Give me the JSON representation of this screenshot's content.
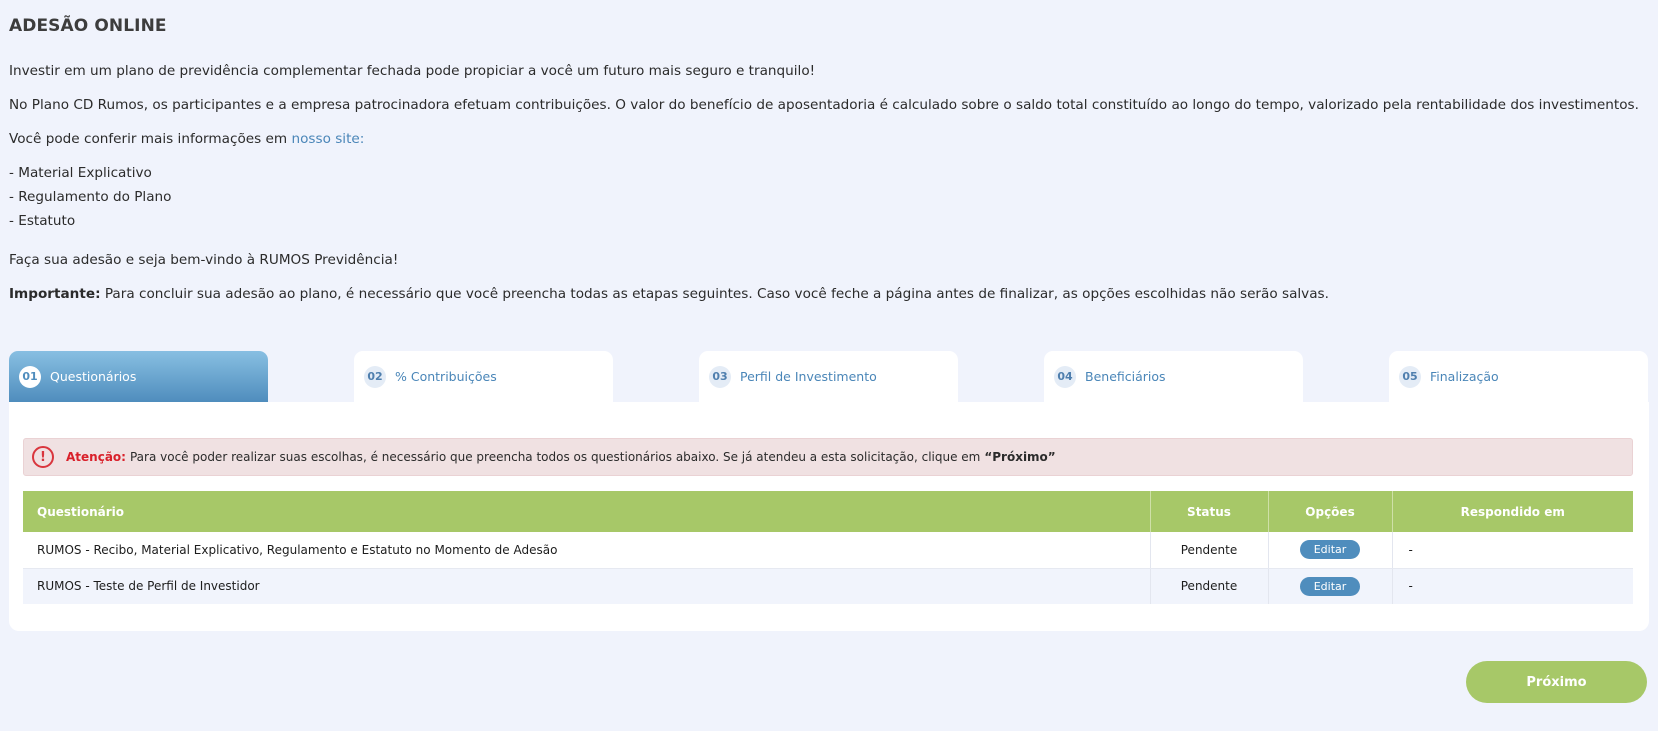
{
  "page": {
    "title": "ADESÃO ONLINE",
    "intro": "Investir em um plano de previdência complementar fechada pode propiciar a você um futuro mais seguro e tranquilo!",
    "plan_text": "No Plano CD Rumos, os participantes e a empresa patrocinadora efetuam contribuições. O valor do benefício de aposentadoria é calculado sobre o saldo total constituído ao longo do tempo, valorizado pela rentabilidade dos investimentos.",
    "info_prefix": "Você pode conferir mais informações em ",
    "info_link": "nosso site:",
    "docs": [
      "- Material Explicativo",
      "- Regulamento do Plano",
      "- Estatuto"
    ],
    "welcome": "Faça sua adesão e seja bem-vindo à RUMOS Previdência!",
    "important_label": "Importante:",
    "important_text": " Para concluir sua adesão ao plano, é necessário que você preencha todas as etapas seguintes. Caso você feche a página antes de finalizar, as opções escolhidas não serão salvas."
  },
  "tabs": [
    {
      "num": "01",
      "label": "Questionários",
      "active": true
    },
    {
      "num": "02",
      "label": "% Contribuições",
      "active": false
    },
    {
      "num": "03",
      "label": "Perfil de Investimento",
      "active": false
    },
    {
      "num": "04",
      "label": "Beneficiários",
      "active": false
    },
    {
      "num": "05",
      "label": "Finalização",
      "active": false
    }
  ],
  "alert": {
    "icon": "exclamation-circle-icon",
    "strong": "Atenção:",
    "text": "Para você poder realizar suas escolhas, é necessário que preencha todos os questionários abaixo. Se já atendeu a esta solicitação, clique em",
    "next": "“Próximo”"
  },
  "table": {
    "headers": [
      "Questionário",
      "Status",
      "Opções",
      "Respondido em"
    ],
    "rows": [
      {
        "name": "RUMOS - Recibo, Material Explicativo, Regulamento e Estatuto no Momento de Adesão",
        "status": "Pendente",
        "action": "Editar",
        "answered": "-"
      },
      {
        "name": "RUMOS - Teste de Perfil de Investidor",
        "status": "Pendente",
        "action": "Editar",
        "answered": "-"
      }
    ]
  },
  "next_button": "Próximo",
  "colors": {
    "background": "#f0f3fc",
    "accent_blue": "#4f8dbd",
    "accent_green": "#a7c868",
    "alert_red": "#d9202a"
  }
}
